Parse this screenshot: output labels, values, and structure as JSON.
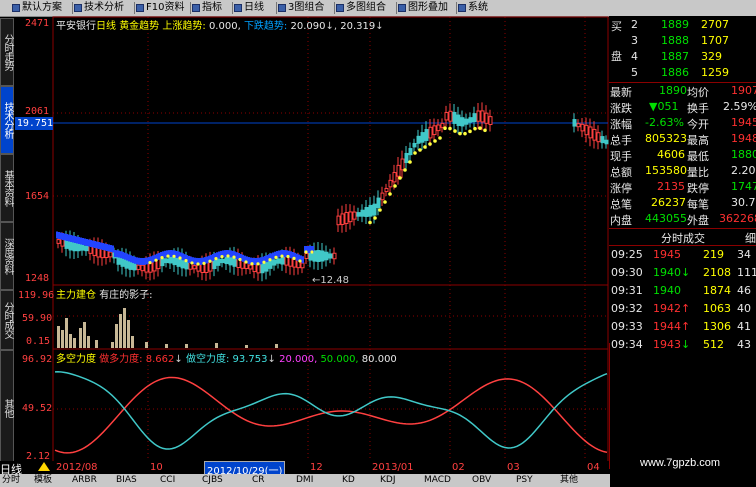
{
  "menu": {
    "items": [
      "默认方案",
      "技术分析",
      "F10资料",
      "指标",
      "日线",
      "3图组合",
      "多图组合",
      "图形叠加",
      "系统"
    ]
  },
  "left_tabs": [
    "分时走势",
    "技术分析",
    "基本资料",
    "深度资料",
    "分时成交",
    "其他"
  ],
  "main_panel": {
    "title_stock": "平安银行",
    "title_period": "日线",
    "title_indicator": "黄金趋势",
    "title_sub": "上涨趋势:",
    "title_v1": "0.000,",
    "title_v2": "下跌趋势:",
    "title_v3": "20.090",
    "title_v4": "20.319",
    "y_labels": [
      "2471",
      "2061",
      "1654",
      "1248"
    ],
    "current_price": "19.751",
    "low_label": "12.48"
  },
  "vol_panel": {
    "title1": "主力建仓",
    "title2": "有庄的影子:",
    "y_labels": [
      "119.96",
      "59.90",
      "0.15"
    ]
  },
  "osc_panel": {
    "title1": "多空力度",
    "title2": "做多力度:",
    "v1": "8.662",
    "title3": "做空力度:",
    "v2": "93.753",
    "v3": "20.000,",
    "v4": "50.000,",
    "v5": "80.000",
    "y_labels": [
      "96.92",
      "49.52",
      "2.12"
    ]
  },
  "date_axis": {
    "labels": [
      "2012/08",
      "10",
      "12",
      "2013/01",
      "02",
      "03",
      "04"
    ],
    "cursor_date": "2012/10/29(一)",
    "period": "日线"
  },
  "right_panel": {
    "buy_label": "买",
    "pan_label": "盘",
    "bids": [
      {
        "level": "2",
        "price": "1889",
        "vol": "2707"
      },
      {
        "level": "3",
        "price": "1888",
        "vol": "1707"
      },
      {
        "level": "4",
        "price": "1887",
        "vol": "329"
      },
      {
        "level": "5",
        "price": "1886",
        "vol": "1259"
      }
    ],
    "quote": [
      {
        "l": "最新",
        "v": "1890",
        "l2": "均价",
        "v2": "1907"
      },
      {
        "l": "涨跌",
        "v": "▼051",
        "l2": "换手",
        "v2": "2.59%"
      },
      {
        "l": "涨幅",
        "v": "-2.63%",
        "l2": "今开",
        "v2": "1945"
      },
      {
        "l": "总手",
        "v": "805323",
        "l2": "最高",
        "v2": "1948"
      },
      {
        "l": "现手",
        "v": "4606",
        "l2": "最低",
        "v2": "1880"
      },
      {
        "l": "总额",
        "v": "153580",
        "l2": "量比",
        "v2": "2.20"
      },
      {
        "l": "涨停",
        "v": "2135",
        "l2": "跌停",
        "v2": "1747"
      },
      {
        "l": "总笔",
        "v": "26237",
        "l2": "每笔",
        "v2": "30.7"
      },
      {
        "l": "内盘",
        "v": "443055",
        "l2": "外盘",
        "v2": "362268"
      }
    ],
    "trades_header": "分时成交",
    "trades_header2": "细",
    "trades": [
      {
        "t": "09:25",
        "p": "1945",
        "d": "",
        "v": "219",
        "n": "34"
      },
      {
        "t": "09:30",
        "p": "1940",
        "d": "↓",
        "v": "2108",
        "n": "111"
      },
      {
        "t": "09:31",
        "p": "1940",
        "d": "",
        "v": "1874",
        "n": "46"
      },
      {
        "t": "09:32",
        "p": "1942",
        "d": "↑",
        "v": "1063",
        "n": "40"
      },
      {
        "t": "09:33",
        "p": "1944",
        "d": "↑",
        "v": "1306",
        "n": "41"
      },
      {
        "t": "09:34",
        "p": "1943",
        "d": "↓",
        "v": "512",
        "n": "43"
      }
    ]
  },
  "bottom_tabs": [
    "分时",
    "模板",
    "ARBR",
    "BIAS",
    "CCI",
    "CJBS",
    "CR",
    "DMI",
    "KD",
    "KDJ",
    "MACD",
    "OBV",
    "PSY",
    "其他"
  ],
  "watermark": "www.7gpzb.com"
}
